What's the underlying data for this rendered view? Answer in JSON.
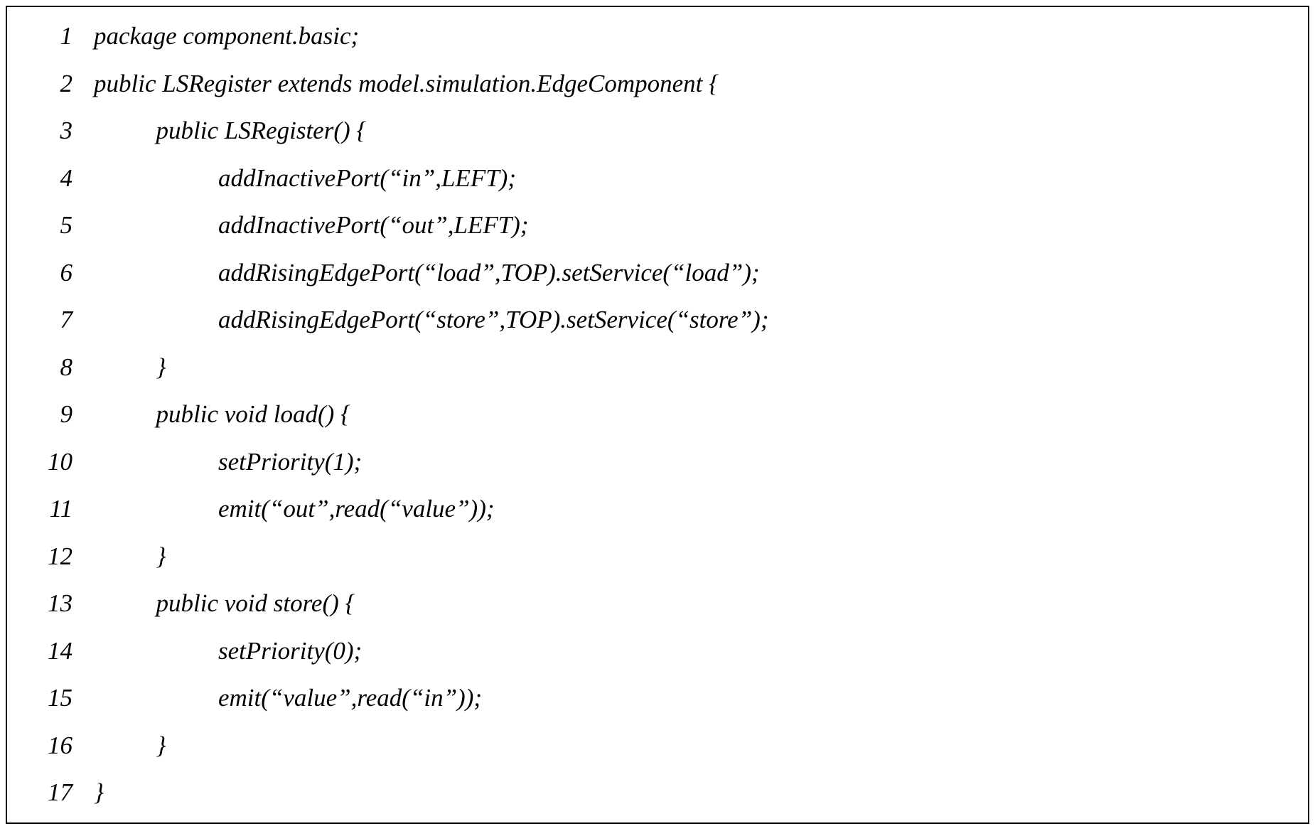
{
  "code": {
    "lines": [
      {
        "n": "1",
        "indent": 0,
        "text": "package component.basic;"
      },
      {
        "n": "2",
        "indent": 0,
        "text": "public LSRegister extends model.simulation.EdgeComponent {"
      },
      {
        "n": "3",
        "indent": 1,
        "text": "public LSRegister() {"
      },
      {
        "n": "4",
        "indent": 2,
        "text": "addInactivePort(“in”,LEFT);"
      },
      {
        "n": "5",
        "indent": 2,
        "text": "addInactivePort(“out”,LEFT);"
      },
      {
        "n": "6",
        "indent": 2,
        "text": "addRisingEdgePort(“load”,TOP).setService(“load”);"
      },
      {
        "n": "7",
        "indent": 2,
        "text": "addRisingEdgePort(“store”,TOP).setService(“store”);"
      },
      {
        "n": "8",
        "indent": 1,
        "text": "}"
      },
      {
        "n": "9",
        "indent": 1,
        "text": "public void load() {"
      },
      {
        "n": "10",
        "indent": 2,
        "text": "setPriority(1);"
      },
      {
        "n": "11",
        "indent": 2,
        "text": "emit(“out”,read(“value”));"
      },
      {
        "n": "12",
        "indent": 1,
        "text": "}"
      },
      {
        "n": "13",
        "indent": 1,
        "text": "public void store() {"
      },
      {
        "n": "14",
        "indent": 2,
        "text": "setPriority(0);"
      },
      {
        "n": "15",
        "indent": 2,
        "text": "emit(“value”,read(“in”));"
      },
      {
        "n": "16",
        "indent": 1,
        "text": "}"
      },
      {
        "n": "17",
        "indent": 0,
        "text": "}"
      }
    ],
    "indent_unit": "          "
  }
}
